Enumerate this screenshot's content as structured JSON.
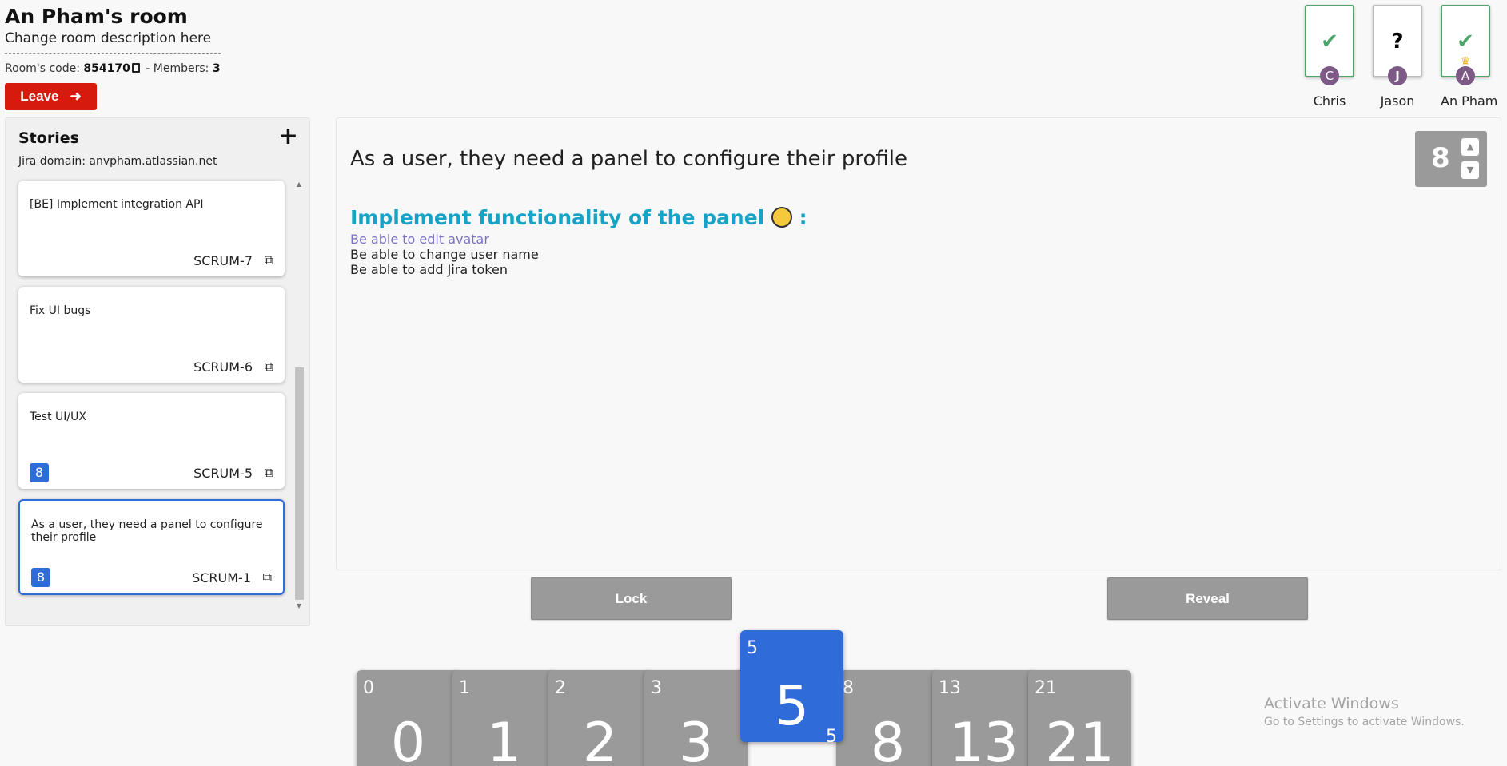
{
  "room": {
    "title": "An Pham's room",
    "description": "Change room description here",
    "code_label": "Room's code: ",
    "code": "854170",
    "members_label": " - Members: ",
    "members_count": "3",
    "leave_label": "Leave"
  },
  "members": [
    {
      "initial": "C",
      "name": "Chris",
      "status": "voted",
      "glyph": "✔"
    },
    {
      "initial": "J",
      "name": "Jason",
      "status": "pending",
      "glyph": "?"
    },
    {
      "initial": "A",
      "name": "An Pham",
      "status": "voted",
      "glyph": "✔",
      "host": true
    }
  ],
  "stories_panel": {
    "title": "Stories",
    "add_icon": "plus-icon",
    "jira_domain": "Jira domain: anvpham.atlassian.net",
    "items": [
      {
        "text": "[BE] Implement integration API",
        "key": "SCRUM-7",
        "points": ""
      },
      {
        "text": "Fix UI bugs",
        "key": "SCRUM-6",
        "points": ""
      },
      {
        "text": "Test UI/UX",
        "key": "SCRUM-5",
        "points": "8"
      },
      {
        "text": "As a user, they need a panel to configure their profile",
        "key": "SCRUM-1",
        "points": "8",
        "selected": true
      }
    ]
  },
  "detail": {
    "title": "As a user, they need a panel to configure their profile",
    "heading": "Implement functionality of the panel",
    "heading_suffix": " :",
    "lines": [
      "Be able to edit avatar",
      "Be able to change user name",
      "Be able to add Jira token"
    ],
    "estimate": "8"
  },
  "actions": {
    "lock_label": "Lock",
    "reveal_label": "Reveal"
  },
  "deck": {
    "cards": [
      "0",
      "1",
      "2",
      "3",
      "5",
      "8",
      "13",
      "21"
    ],
    "selected": "5"
  },
  "watermark": {
    "line1": "Activate Windows",
    "line2": "Go to Settings to activate Windows."
  },
  "colors": {
    "accent": "#2f6bd9",
    "leave": "#d71a0e",
    "voted": "#4ca56b",
    "heading": "#17a3c6",
    "card": "#9a9a9a"
  }
}
